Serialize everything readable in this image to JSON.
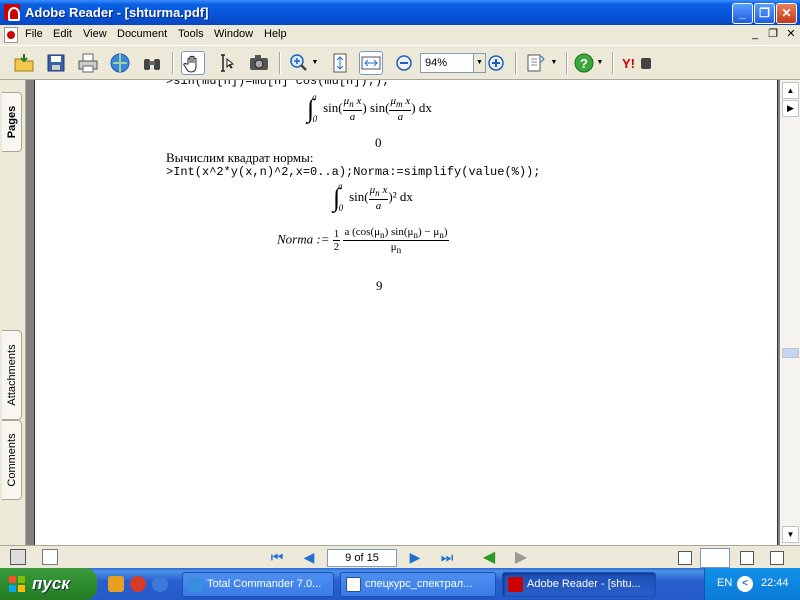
{
  "window": {
    "title": "Adobe Reader - [shturma.pdf]"
  },
  "menu": [
    "File",
    "Edit",
    "View",
    "Document",
    "Tools",
    "Window",
    "Help"
  ],
  "toolbar": {
    "zoom_value": "94%"
  },
  "nav_tabs": [
    "Pages",
    "Attachments",
    "Comments"
  ],
  "document": {
    "line_cut": ">sin(mu[n])=mu[n]*cos(mu[n]););",
    "integral1": {
      "lower": "0",
      "upper": "a",
      "f1": "sin(",
      "n1": "μ",
      "sub1": "n",
      "x1": " x",
      "d1": "a",
      "f2": ") sin(",
      "n2": "μ",
      "sub2": "m",
      "x2": " x",
      "d2": "a",
      "tail": ") dx"
    },
    "result1": "0",
    "text_norm": "Вычислим квадрат нормы:",
    "command": ">Int(x^2*y(x,n)^2,x=0..a);Norma:=simplify(value(%));",
    "integral2": {
      "lower": "0",
      "upper": "a",
      "f1": "sin(",
      "n1": "μ",
      "sub1": "n",
      "x1": " x",
      "d1": "a",
      "tail": ")² dx"
    },
    "norma": {
      "lhs": "Norma :=",
      "half_num": "1",
      "half_den": "2",
      "num": "a (cos(μ",
      "num_sub1": "n",
      "num_mid": ") sin(μ",
      "num_sub2": "n",
      "num_end": ") − μ",
      "num_sub3": "n",
      "num_close": ")",
      "den": "μ",
      "den_sub": "n"
    },
    "page_number": "9"
  },
  "statusbar": {
    "page_indicator": "9 of 15"
  },
  "taskbar": {
    "start_label": "пуск",
    "tasks": [
      {
        "label": "Total Commander 7.0..."
      },
      {
        "label": "спецкурс_спектрал..."
      },
      {
        "label": "Adobe Reader - [shtu..."
      }
    ],
    "lang": "EN",
    "clock": "22:44"
  }
}
